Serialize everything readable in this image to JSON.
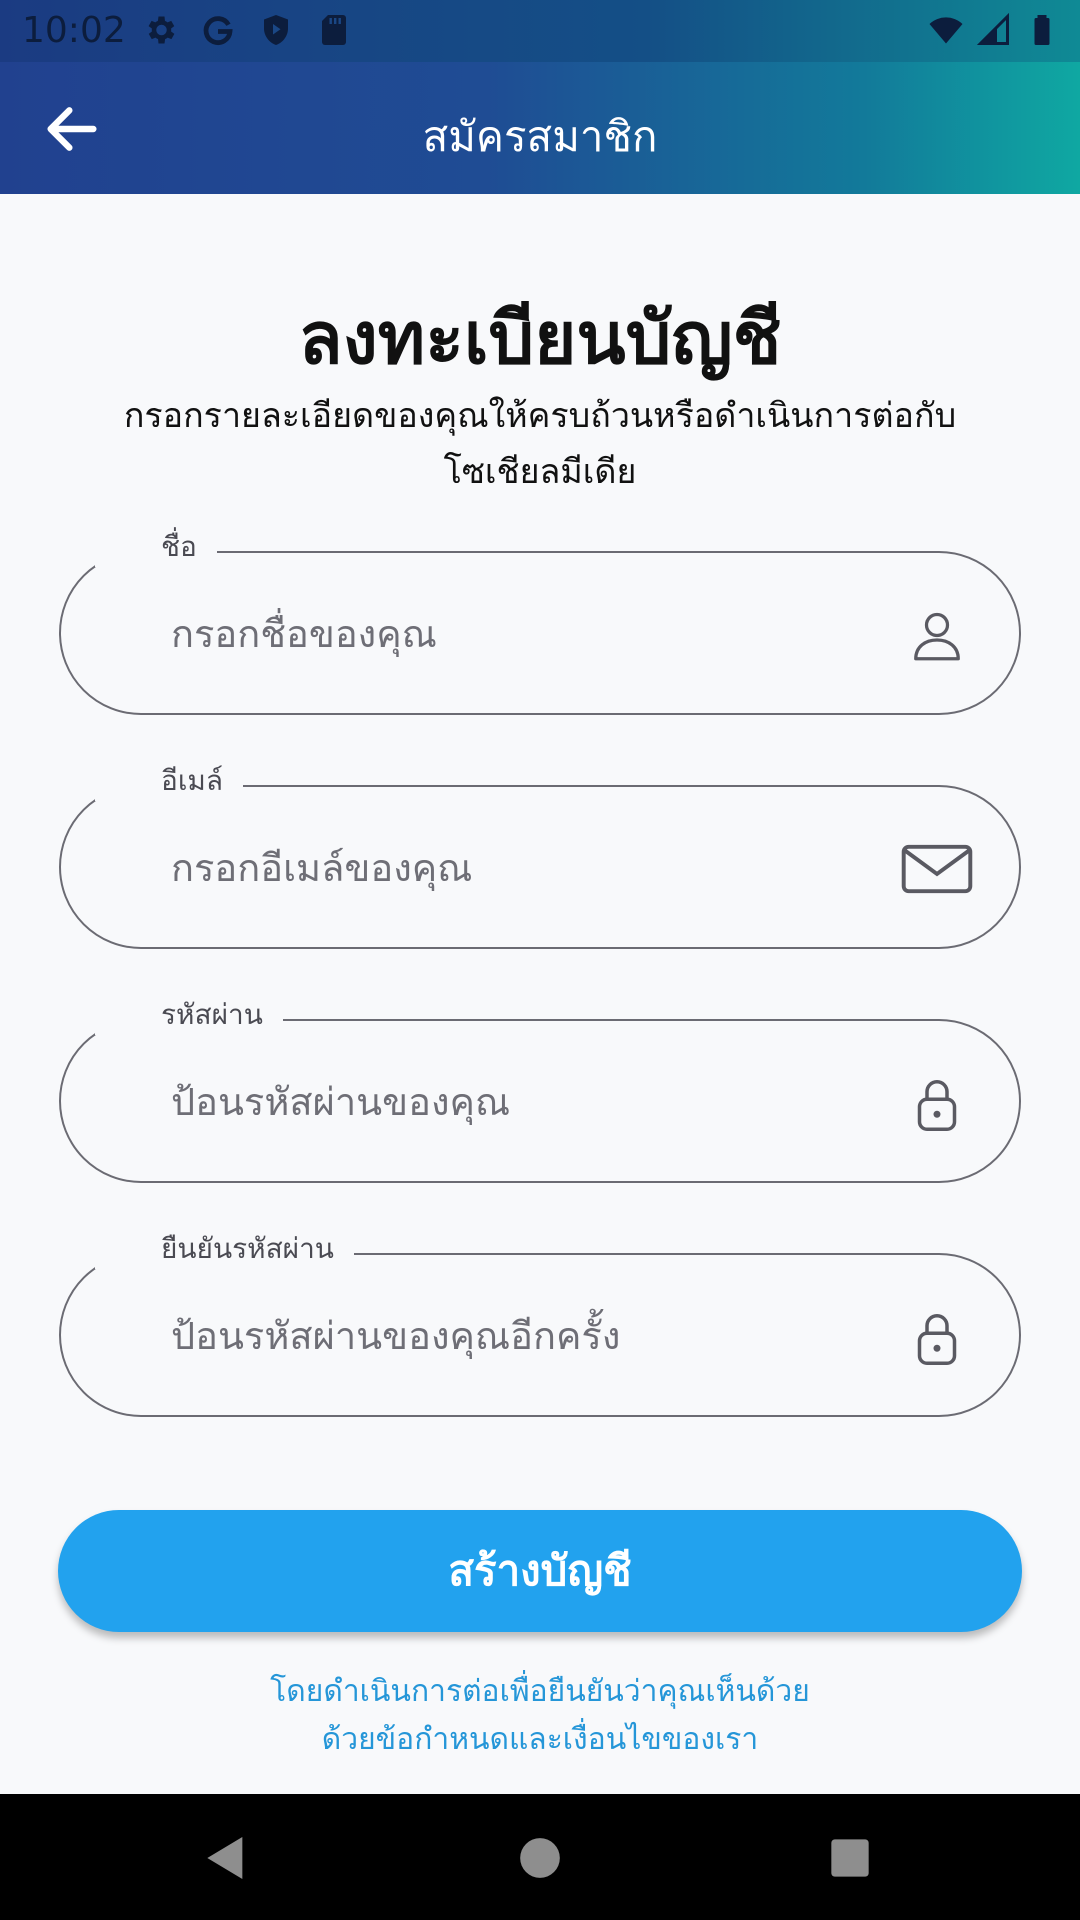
{
  "status_bar": {
    "time": "10:02",
    "left_icons": [
      "gear-icon",
      "google-icon",
      "shield-play-icon",
      "sd-card-icon"
    ],
    "right_icons": [
      "wifi-icon",
      "cell-signal-icon",
      "battery-icon"
    ]
  },
  "app_bar": {
    "title": "สมัครสมาชิก",
    "back_icon": "arrow-left-icon",
    "gradient": [
      "#21418f",
      "#0fa8a2"
    ]
  },
  "form": {
    "heading": "ลงทะเบียนบัญชี",
    "subtitle": "กรอกรายละเอียดของคุณให้ครบถ้วนหรือดำเนินการต่อกับโซเชียลมีเดีย",
    "fields": [
      {
        "label": "ชื่อ",
        "placeholder": "กรอกชื่อของคุณ",
        "icon": "person-icon"
      },
      {
        "label": "อีเมล์",
        "placeholder": "กรอกอีเมล์ของคุณ",
        "icon": "envelope-icon"
      },
      {
        "label": "รหัสผ่าน",
        "placeholder": "ป้อนรหัสผ่านของคุณ",
        "icon": "lock-icon"
      },
      {
        "label": "ยืนยันรหัสผ่าน",
        "placeholder": "ป้อนรหัสผ่านของคุณอีกครั้ง",
        "icon": "lock-icon"
      }
    ],
    "submit_label": "สร้างบัญชี",
    "submit_color": "#22a2ee",
    "terms_line1": "โดยดำเนินการต่อเพื่อยืนยันว่าคุณเห็นด้วย",
    "terms_line2": "ด้วยข้อกำหนดและเงื่อนไขของเรา",
    "terms_color": "#2596d8"
  },
  "nav_bar": {
    "items": [
      "back-triangle-icon",
      "home-circle-icon",
      "recents-square-icon"
    ]
  }
}
